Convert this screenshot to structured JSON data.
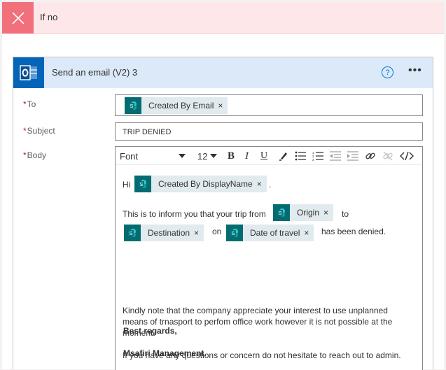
{
  "branch": {
    "title": "If no"
  },
  "action": {
    "title": "Send an email (V2) 3",
    "help_label": "?",
    "more_label": "•••"
  },
  "fields": {
    "to": {
      "label": "To",
      "required_mark": "*",
      "tokens": [
        {
          "label": "Created By Email",
          "remove": "×"
        }
      ]
    },
    "subject": {
      "label": "Subject",
      "required_mark": "*",
      "value": "TRIP DENIED"
    },
    "body": {
      "label": "Body",
      "required_mark": "*",
      "toolbar": {
        "font": "Font",
        "size": "12",
        "bold": "B",
        "italic": "I",
        "underline": "U"
      },
      "content": {
        "greeting": "Hi",
        "greeting_token": "Created By DisplayName",
        "greeting_end": ".",
        "inform": "This is to inform you that your trip from",
        "origin_token": "Origin",
        "to_word": "to",
        "destination_token": "Destination",
        "on_word": "on",
        "date_token": "Date of travel",
        "denied": "has been denied.",
        "kindly_1": "Kindly note that the company appreciate your interest to use unplanned",
        "kindly_2": "means of trnasport to perfom office work however it is not possible at the",
        "kindly_3": "moment.",
        "questions": "If you have any questions or concern do not hesitate to reach out to admin.",
        "regards": "Best regards,",
        "signature": "Msafiri Management."
      },
      "token_remove": "×"
    }
  },
  "colors": {
    "branch_header_bg": "#fde7e9",
    "branch_x_bg": "#f1707b",
    "action_header_bg": "#dbe9f9",
    "outlook_blue": "#0364b8",
    "sharepoint_teal": "#036c70",
    "token_bg": "#e1eaee",
    "required_red": "#a4262c"
  },
  "icons": {
    "branch": "close-icon",
    "action": "outlook-icon",
    "token": "sharepoint-icon"
  }
}
